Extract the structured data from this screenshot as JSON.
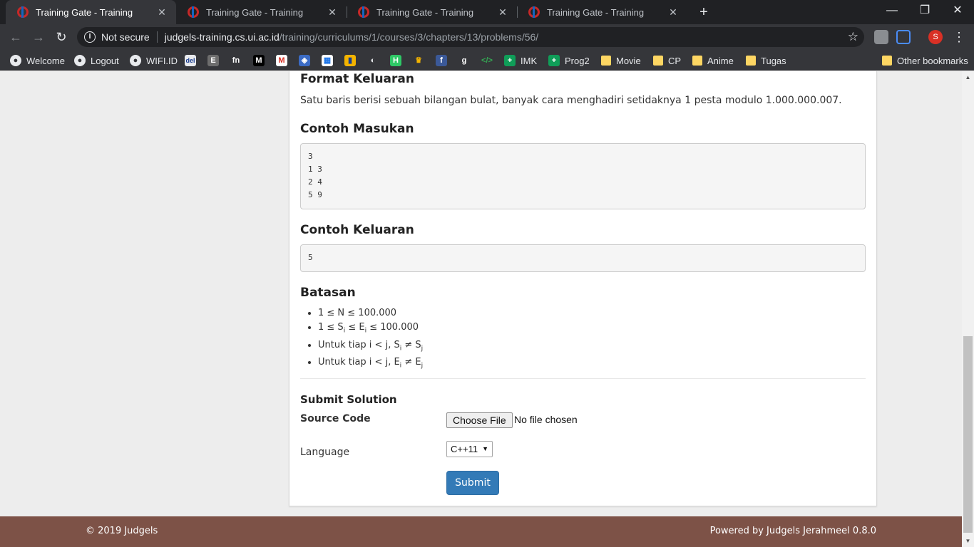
{
  "browser": {
    "tabs": [
      {
        "title": "Training Gate - Training",
        "active": true
      },
      {
        "title": "Training Gate - Training",
        "active": false
      },
      {
        "title": "Training Gate - Training",
        "active": false
      },
      {
        "title": "Training Gate - Training",
        "active": false
      }
    ],
    "tab_close": "✕",
    "new_tab": "+",
    "window_controls": {
      "minimize": "—",
      "maximize": "❐",
      "close": "✕"
    },
    "nav": {
      "back": "←",
      "forward": "→",
      "reload": "↻"
    },
    "omnibox": {
      "security_label": "Not secure",
      "host": "judgels-training.cs.ui.ac.id",
      "path": "/training/curriculums/1/courses/3/chapters/13/problems/56/",
      "bookmark_star": "☆"
    },
    "profile_initial": "S",
    "menu": "⋮",
    "bookmarks": [
      {
        "label": "Welcome",
        "icon": "globe-icon"
      },
      {
        "label": "Logout",
        "icon": "globe-icon"
      },
      {
        "label": "WIFI.ID",
        "icon": "globe-icon"
      },
      {
        "label": "",
        "icon": "del-icon"
      },
      {
        "label": "",
        "icon": "excel-icon"
      },
      {
        "label": "",
        "icon": "fn-icon"
      },
      {
        "label": "",
        "icon": "medium-icon"
      },
      {
        "label": "",
        "icon": "gmail-icon"
      },
      {
        "label": "",
        "icon": "codeforces-icon"
      },
      {
        "label": "",
        "icon": "calendar-icon"
      },
      {
        "label": "",
        "icon": "chart-icon"
      },
      {
        "label": "",
        "icon": "game-icon"
      },
      {
        "label": "",
        "icon": "hackerrank-icon"
      },
      {
        "label": "",
        "icon": "trophy-icon"
      },
      {
        "label": "",
        "icon": "facebook-icon"
      },
      {
        "label": "",
        "icon": "g-icon"
      },
      {
        "label": "",
        "icon": "code-icon"
      },
      {
        "label": "IMK",
        "icon": "sheets-icon"
      },
      {
        "label": "Prog2",
        "icon": "sheets-icon"
      },
      {
        "label": "Movie",
        "icon": "folder-icon"
      },
      {
        "label": "CP",
        "icon": "folder-icon"
      },
      {
        "label": "Anime",
        "icon": "folder-icon"
      },
      {
        "label": "Tugas",
        "icon": "folder-icon"
      },
      {
        "label": "Other bookmarks",
        "icon": "folder-icon"
      }
    ],
    "colors": {
      "frame": "#202124",
      "toolbar": "#35363a",
      "accent": "#d93025"
    }
  },
  "problem": {
    "output_format": {
      "heading": "Format Keluaran",
      "text": "Satu baris berisi sebuah bilangan bulat, banyak cara menghadiri setidaknya 1 pesta modulo 1.000.000.007."
    },
    "sample_input": {
      "heading": "Contoh Masukan",
      "content": "3\n1 3\n2 4\n5 9"
    },
    "sample_output": {
      "heading": "Contoh Keluaran",
      "content": "5"
    },
    "constraints": {
      "heading": "Batasan",
      "items": [
        {
          "text": "1 ≤ N ≤ 100.000"
        },
        {
          "pre": "1 ≤ S",
          "sub1": "i",
          "mid": " ≤ E",
          "sub2": "i",
          "post": " ≤ 100.000"
        },
        {
          "pre": "Untuk tiap i < j, S",
          "sub1": "i",
          "mid": " ≠ S",
          "sub2": "j",
          "post": ""
        },
        {
          "pre": "Untuk tiap i < j, E",
          "sub1": "i",
          "mid": " ≠ E",
          "sub2": "j",
          "post": ""
        }
      ]
    }
  },
  "submission": {
    "title": "Submit Solution",
    "source_label": "Source Code",
    "file_button": "Choose File",
    "file_status": "No file chosen",
    "language_label": "Language",
    "language_value": "C++11",
    "submit_label": "Submit"
  },
  "footer": {
    "copyright": "© 2019 Judgels",
    "powered_by": "Powered by Judgels Jerahmeel 0.8.0",
    "color": "#7d5247"
  }
}
